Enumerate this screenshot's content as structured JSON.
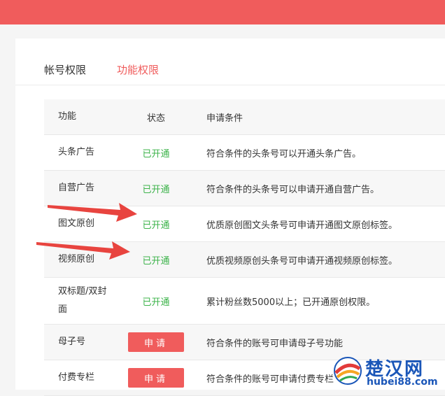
{
  "tabs": {
    "account": "帐号权限",
    "function": "功能权限"
  },
  "table": {
    "headers": {
      "feature": "功能",
      "status": "状态",
      "condition": "申请条件"
    },
    "rows": [
      {
        "feature": "头条广告",
        "status": "已开通",
        "condition": "符合条件的头条号可以开通头条广告。"
      },
      {
        "feature": "自营广告",
        "status": "已开通",
        "condition": "符合条件的头条号可以申请开通自营广告。"
      },
      {
        "feature": "图文原创",
        "status": "已开通",
        "condition": "优质原创图文头条号可申请开通图文原创标签。"
      },
      {
        "feature": "视频原创",
        "status": "已开通",
        "condition": "优质视频原创头条号可申请开通视频原创标签。"
      },
      {
        "feature": "双标题/双封面",
        "status": "已开通",
        "condition": "累计粉丝数5000以上；已开通原创权限。"
      },
      {
        "feature": "母子号",
        "button": "申请",
        "condition": "符合条件的账号可申请母子号功能"
      },
      {
        "feature": "付费专栏",
        "button": "申请",
        "condition": "符合条件的账号可申请付费专栏"
      }
    ]
  },
  "watermark": {
    "cn": "楚汉网",
    "en": "hubei88.com"
  },
  "colors": {
    "accent": "#f05c5c",
    "status_green": "#3cb34a",
    "arrow_red": "#e8443f",
    "logo_blue": "#1a56b8"
  }
}
